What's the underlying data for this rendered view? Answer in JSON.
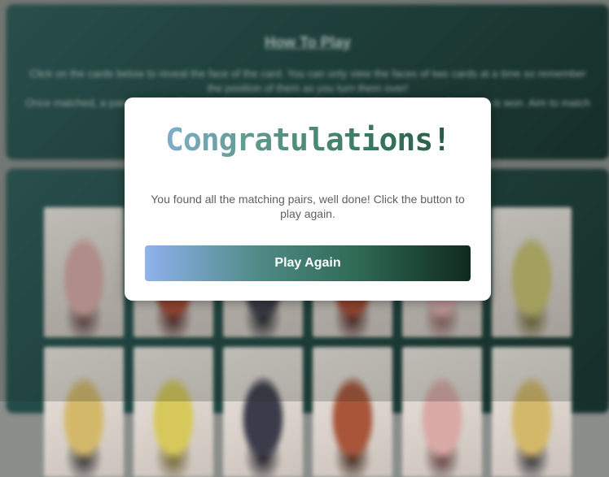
{
  "how_to_play": {
    "title": "How To Play",
    "text_line1": "Click on the cards below to reveal the face of the card. You can only view the faces of two cards at a time so remember the position of them as you turn them over!",
    "text_line2": "Once matched, a pair of cards will remain face-up and once all pairs have been revealed, the game is won. Aim to match all pairs using as few moves as possible."
  },
  "cards": [
    {
      "name": "card-rabbit-1",
      "palette": [
        "#d9a9a5",
        "#5a3a3a"
      ]
    },
    {
      "name": "card-red-beast-1",
      "palette": [
        "#b04a32",
        "#4a2020"
      ]
    },
    {
      "name": "card-dark-warrior-1",
      "palette": [
        "#3b3b4a",
        "#1a1a22"
      ]
    },
    {
      "name": "card-red-beast-2",
      "palette": [
        "#b04a32",
        "#4a2020"
      ]
    },
    {
      "name": "card-pink-creature-1",
      "palette": [
        "#e3b3b6",
        "#8a5a5a"
      ]
    },
    {
      "name": "card-chocobo-1",
      "palette": [
        "#c8c070",
        "#6a6030"
      ]
    },
    {
      "name": "card-blond-soldier-1",
      "palette": [
        "#d4b86a",
        "#2a2a30"
      ]
    },
    {
      "name": "card-chocobo-2",
      "palette": [
        "#d6c85a",
        "#6a6030"
      ]
    },
    {
      "name": "card-dark-warrior-2",
      "palette": [
        "#3b3b4a",
        "#1a1a22"
      ]
    },
    {
      "name": "card-redhead-1",
      "palette": [
        "#a8553a",
        "#3a2418"
      ]
    },
    {
      "name": "card-rabbit-2",
      "palette": [
        "#d9a9a5",
        "#5a3a3a"
      ]
    },
    {
      "name": "card-blond-soldier-2",
      "palette": [
        "#d4b86a",
        "#2a2a30"
      ]
    }
  ],
  "modal": {
    "title": "Congratulations!",
    "message": "You found all the matching pairs, well done! Click the button to play again.",
    "button_label": "Play Again"
  }
}
